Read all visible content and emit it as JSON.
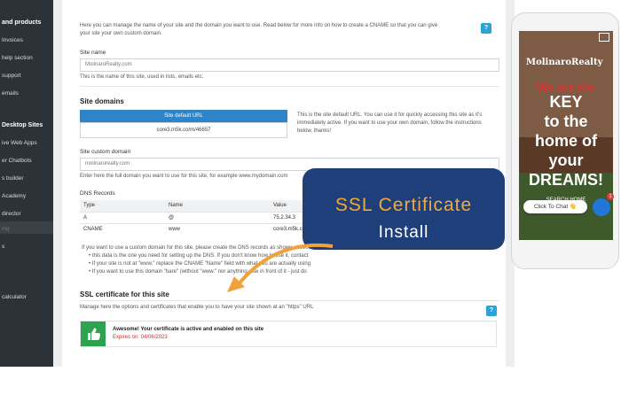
{
  "sidebar": {
    "items": [
      {
        "label": "and products",
        "style": "header"
      },
      {
        "label": "Invoices",
        "style": "normal"
      },
      {
        "label": "help section",
        "style": "normal"
      },
      {
        "label": "support",
        "style": "normal"
      },
      {
        "label": "emails",
        "style": "normal"
      },
      {
        "label": "Desktop Sites",
        "style": "header"
      },
      {
        "label": "ive Web Apps",
        "style": "normal"
      },
      {
        "label": "er Chatbots",
        "style": "normal"
      },
      {
        "label": "s builder",
        "style": "normal"
      },
      {
        "label": "Academy",
        "style": "normal"
      },
      {
        "label": "director",
        "style": "normal"
      },
      {
        "label": "ing",
        "style": "muted"
      },
      {
        "label": "s",
        "style": "normal"
      },
      {
        "label": "calculator",
        "style": "normal"
      }
    ]
  },
  "intro": {
    "text_line1": "Here you can manage the name of your site and the domain you want to use. Read below for more info on how to create a CNAME so that you can give",
    "text_line2": "your site your own custom domain."
  },
  "site_name": {
    "label": "Site name",
    "value": "MolinaroRealty.com",
    "help": "This is the name of this site, used in lists, emails etc."
  },
  "site_domains": {
    "heading": "Site domains",
    "default_url_label": "Site default URL",
    "default_url_value": "core3.m5k.co/m/46657",
    "description_line1": "This is the site default URL. You can use it for quickly accessing this site as it's",
    "description_line2": "immediately active. If you want to use your own domain, follow the instructions",
    "description_line3": "below, thanks!"
  },
  "custom_domain": {
    "label": "Site custom domain",
    "value": "molinarorealty.com",
    "help": "Enter here the full domain you want to use for this site, for example www.mydomain.com"
  },
  "dns": {
    "heading": "DNS Records",
    "columns": [
      "Type",
      "Name",
      "Value"
    ],
    "rows": [
      [
        "A",
        "@",
        "75.2.34.3"
      ],
      [
        "CNAME",
        "www",
        "core3.m5k.co"
      ]
    ],
    "note": "If you want to use a custom domain for this site, please create the DNS records as shown above. A",
    "bullets": [
      "this data is the one you need for setting up the DNS. If you don't know how to use it, contact",
      "If your site is not at \"www.\" replace the CNAME \"Name\" field with what you are actually using",
      "If you want to use this domain \"bare\" (without \"www.\" nor anything else in front of it - just do"
    ]
  },
  "ssl": {
    "heading": "SSL certificate for this site",
    "description": "Manage here the options and certificates that enable you to have your site shown at an \"https\" URL",
    "status": "Awesome! Your certificate is active and enabled on this site",
    "expires": "Expires on: 04/06/2023"
  },
  "help_button_label": "?",
  "overlay": {
    "line1": "SSL Certificate",
    "line2": "Install",
    "accent_color": "#f2a93b",
    "bg_color": "#1f3f7a"
  },
  "phone": {
    "logo_text": "MolinaroRealty",
    "hero_lines": [
      "We are the",
      "KEY",
      "to the",
      "home of",
      "your",
      "DREAMS!"
    ],
    "chat_label": "Click To Chat 👋",
    "search_label": "SEARCH HOME",
    "unread_count": "1"
  }
}
